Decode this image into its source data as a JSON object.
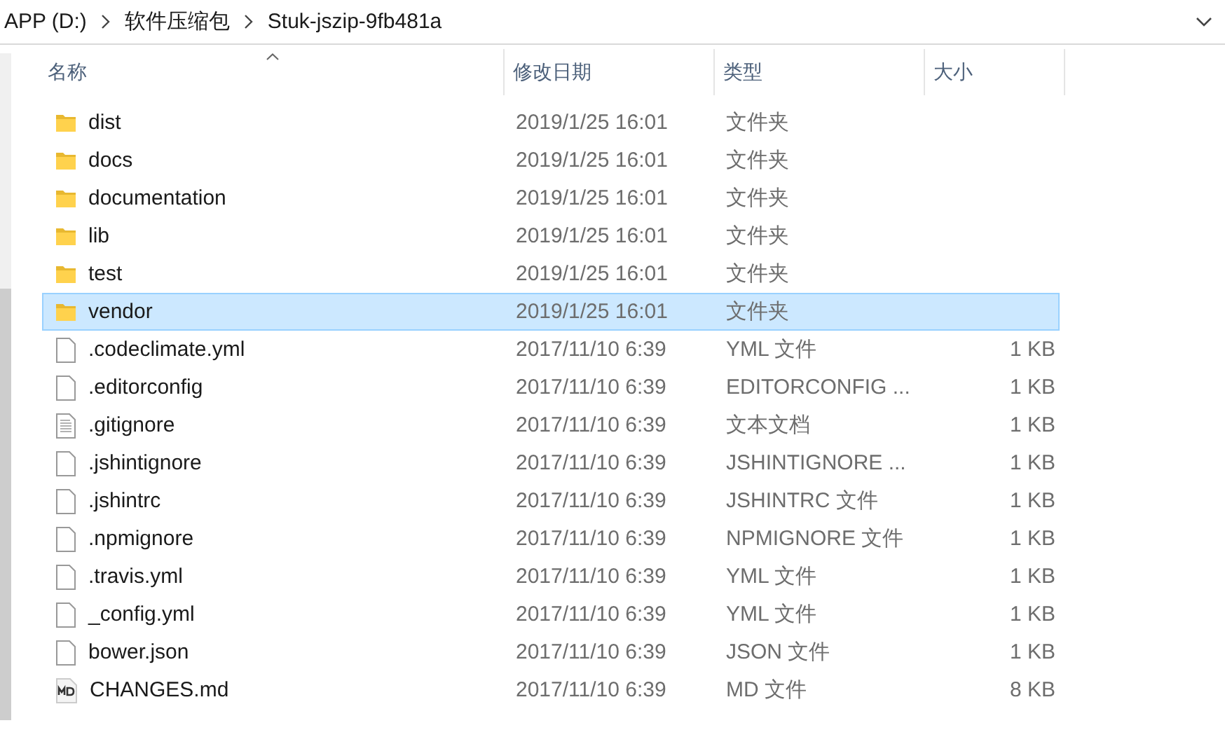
{
  "address_bar": {
    "crumbs": [
      "APP (D:)",
      "软件压缩包",
      "Stuk-jszip-9fb481a"
    ]
  },
  "table": {
    "columns": [
      "名称",
      "修改日期",
      "类型",
      "大小"
    ],
    "rows": [
      {
        "kind": "folder",
        "name": "dist",
        "date": "2019/1/25 16:01",
        "type": "文件夹",
        "size": "",
        "selected": false
      },
      {
        "kind": "folder",
        "name": "docs",
        "date": "2019/1/25 16:01",
        "type": "文件夹",
        "size": "",
        "selected": false
      },
      {
        "kind": "folder",
        "name": "documentation",
        "date": "2019/1/25 16:01",
        "type": "文件夹",
        "size": "",
        "selected": false
      },
      {
        "kind": "folder",
        "name": "lib",
        "date": "2019/1/25 16:01",
        "type": "文件夹",
        "size": "",
        "selected": false
      },
      {
        "kind": "folder",
        "name": "test",
        "date": "2019/1/25 16:01",
        "type": "文件夹",
        "size": "",
        "selected": false
      },
      {
        "kind": "folder",
        "name": "vendor",
        "date": "2019/1/25 16:01",
        "type": "文件夹",
        "size": "",
        "selected": true
      },
      {
        "kind": "file",
        "name": ".codeclimate.yml",
        "date": "2017/11/10 6:39",
        "type": "YML 文件",
        "size": "1 KB",
        "selected": false
      },
      {
        "kind": "file",
        "name": ".editorconfig",
        "date": "2017/11/10 6:39",
        "type": "EDITORCONFIG ...",
        "size": "1 KB",
        "selected": false
      },
      {
        "kind": "text",
        "name": ".gitignore",
        "date": "2017/11/10 6:39",
        "type": "文本文档",
        "size": "1 KB",
        "selected": false
      },
      {
        "kind": "file",
        "name": ".jshintignore",
        "date": "2017/11/10 6:39",
        "type": "JSHINTIGNORE ...",
        "size": "1 KB",
        "selected": false
      },
      {
        "kind": "file",
        "name": ".jshintrc",
        "date": "2017/11/10 6:39",
        "type": "JSHINTRC 文件",
        "size": "1 KB",
        "selected": false
      },
      {
        "kind": "file",
        "name": ".npmignore",
        "date": "2017/11/10 6:39",
        "type": "NPMIGNORE 文件",
        "size": "1 KB",
        "selected": false
      },
      {
        "kind": "file",
        "name": ".travis.yml",
        "date": "2017/11/10 6:39",
        "type": "YML 文件",
        "size": "1 KB",
        "selected": false
      },
      {
        "kind": "file",
        "name": "_config.yml",
        "date": "2017/11/10 6:39",
        "type": "YML 文件",
        "size": "1 KB",
        "selected": false
      },
      {
        "kind": "file",
        "name": "bower.json",
        "date": "2017/11/10 6:39",
        "type": "JSON 文件",
        "size": "1 KB",
        "selected": false
      },
      {
        "kind": "md",
        "name": "CHANGES.md",
        "date": "2017/11/10 6:39",
        "type": "MD 文件",
        "size": "8 KB",
        "selected": false
      }
    ]
  }
}
